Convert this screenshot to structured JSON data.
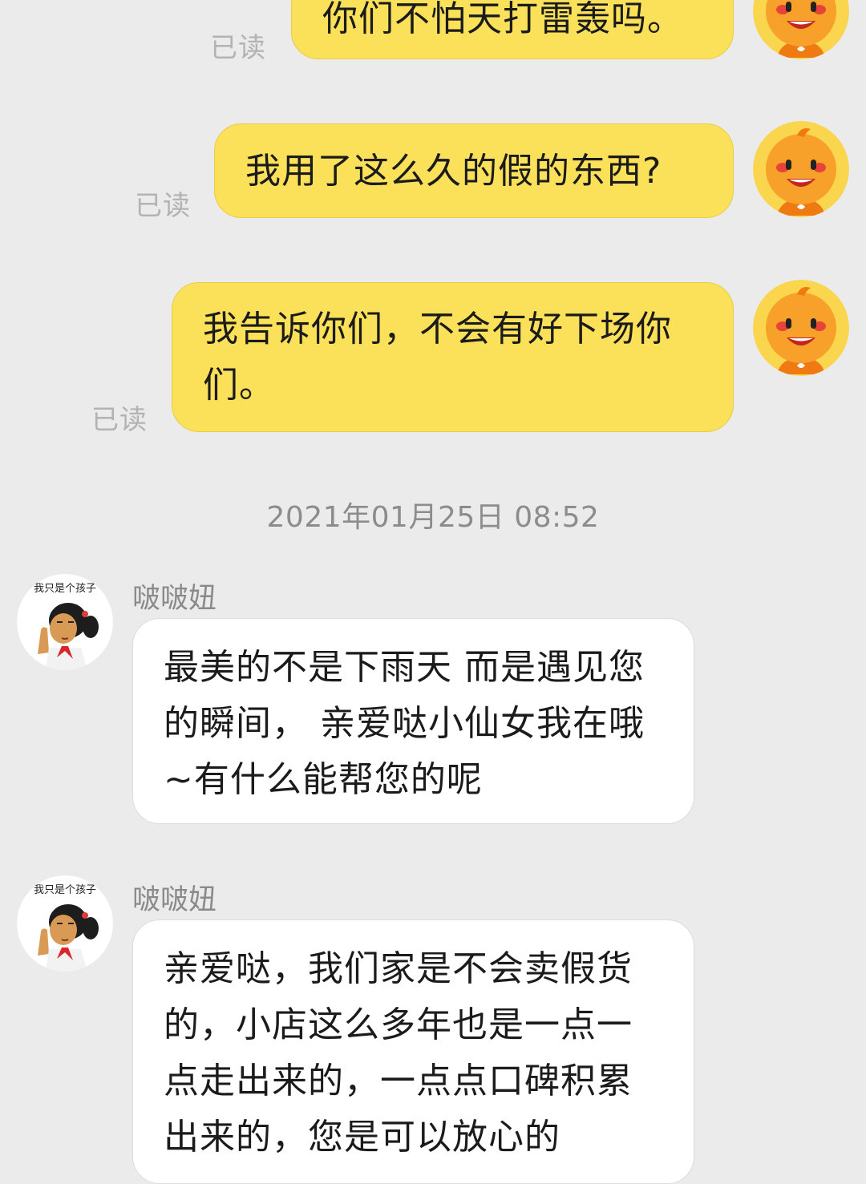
{
  "messages_out": [
    {
      "text": "你们不怕天打雷轰吗。",
      "status": "已读"
    },
    {
      "text": "我用了这么久的假的东西?",
      "status": "已读"
    },
    {
      "text": "我告诉你们，不会有好下场你们。",
      "status": "已读"
    }
  ],
  "timestamp": "2021年01月25日 08:52",
  "messages_in": [
    {
      "sender": "啵啵妞",
      "avatar_caption": "我只是个孩子",
      "text": "最美的不是下雨天 而是遇见您的瞬间， 亲爱哒小仙女我在哦~有什么能帮您的呢"
    },
    {
      "sender": "啵啵妞",
      "avatar_caption": "我只是个孩子",
      "text": "亲爱哒，我们家是不会卖假货的，小店这么多年也是一点一点走出来的，一点点口碑积累出来的，您是可以放心的"
    }
  ],
  "colors": {
    "background": "#ebebeb",
    "outgoing_bubble": "#fbe05a",
    "incoming_bubble": "#ffffff",
    "read_status": "#b3b3b3",
    "avatar_orange": "#f8a12a"
  },
  "icons": {
    "user_avatar": "orange-mascot-avatar-icon",
    "agent_avatar": "girl-cartoon-avatar-icon"
  }
}
